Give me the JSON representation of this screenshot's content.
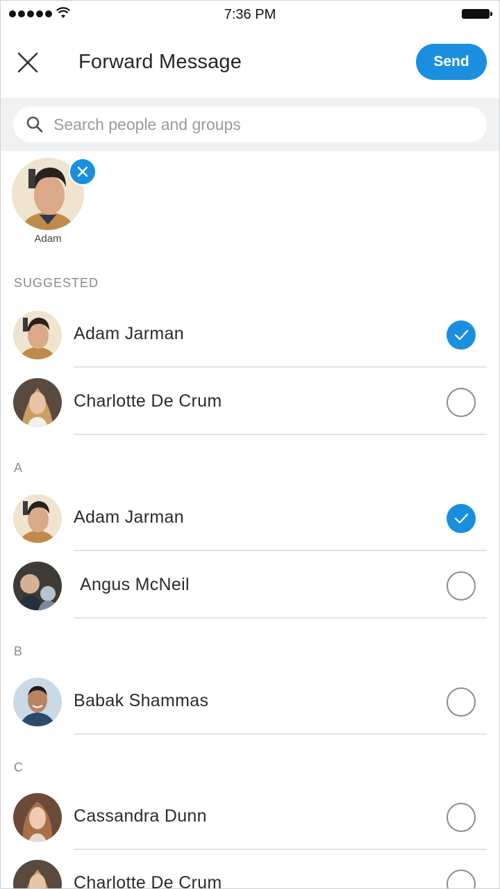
{
  "status": {
    "time": "7:36 PM"
  },
  "header": {
    "title": "Forward Message",
    "send_label": "Send"
  },
  "search": {
    "placeholder": "Search people and groups",
    "value": ""
  },
  "selected": [
    {
      "name": "Adam"
    }
  ],
  "sections": [
    {
      "label": "SUGGESTED",
      "rows": [
        {
          "name": "Adam Jarman",
          "checked": true
        },
        {
          "name": "Charlotte De Crum",
          "checked": false
        }
      ]
    },
    {
      "label": "A",
      "rows": [
        {
          "name": "Adam Jarman",
          "checked": true
        },
        {
          "name": "Angus McNeil",
          "checked": false
        }
      ]
    },
    {
      "label": "B",
      "rows": [
        {
          "name": "Babak Shammas",
          "checked": false
        }
      ]
    },
    {
      "label": "C",
      "rows": [
        {
          "name": "Cassandra Dunn",
          "checked": false
        },
        {
          "name": "Charlotte De Crum",
          "checked": false
        }
      ]
    }
  ],
  "colors": {
    "accent": "#1a8fe0",
    "search_band": "#f0f1f3"
  }
}
